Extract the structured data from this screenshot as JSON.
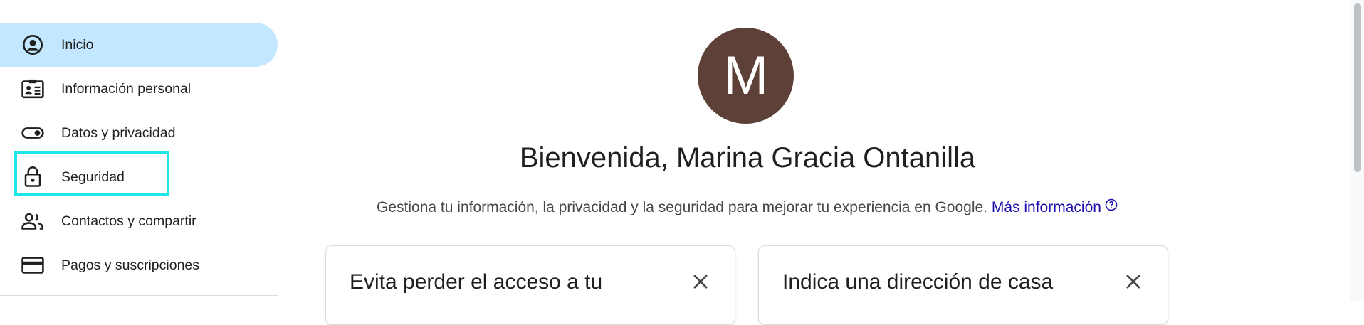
{
  "sidebar": {
    "items": [
      {
        "label": "Inicio",
        "icon": "account-circle-icon",
        "active": true
      },
      {
        "label": "Información personal",
        "icon": "id-card-icon"
      },
      {
        "label": "Datos y privacidad",
        "icon": "toggle-icon"
      },
      {
        "label": "Seguridad",
        "icon": "lock-icon"
      },
      {
        "label": "Contactos y compartir",
        "icon": "people-icon"
      },
      {
        "label": "Pagos y suscripciones",
        "icon": "credit-card-icon"
      }
    ]
  },
  "profile": {
    "avatar_initial": "M",
    "avatar_color": "#5d4037",
    "welcome": "Bienvenida, Marina Gracia Ontanilla",
    "subtitle": "Gestiona tu información, la privacidad y la seguridad para mejorar tu experiencia en Google.",
    "more_info_link": "Más información"
  },
  "cards": [
    {
      "title": "Evita perder el acceso a tu"
    },
    {
      "title": "Indica una dirección de casa"
    }
  ],
  "colors": {
    "active_nav": "#c2e7ff",
    "highlight": "#1ee6e6",
    "link": "#1a0dab"
  }
}
